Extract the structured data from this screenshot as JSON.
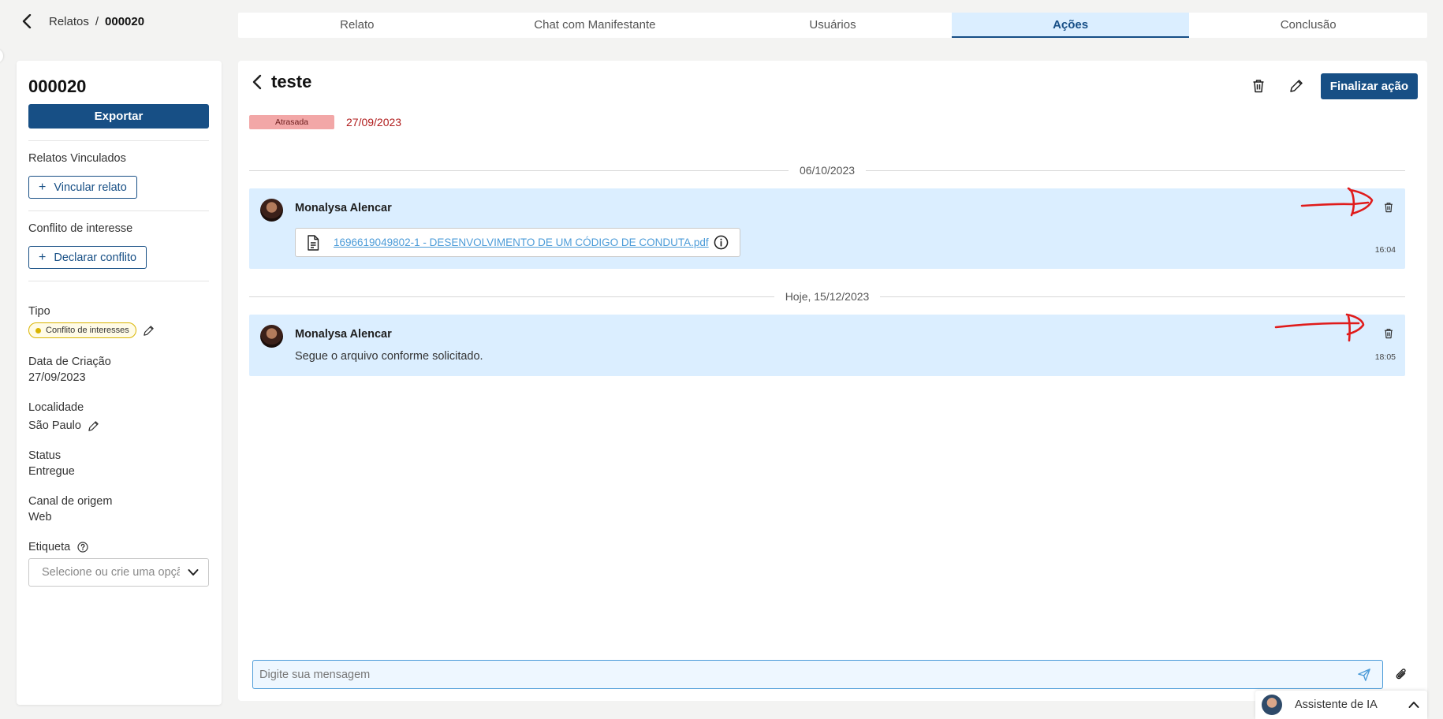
{
  "breadcrumb": {
    "parent": "Relatos",
    "separator": "/",
    "current": "000020"
  },
  "tabs": [
    {
      "label": "Relato"
    },
    {
      "label": "Chat com Manifestante"
    },
    {
      "label": "Usuários"
    },
    {
      "label": "Ações",
      "active": true
    },
    {
      "label": "Conclusão"
    }
  ],
  "sidebar": {
    "case_id": "000020",
    "export_label": "Exportar",
    "linked_reports_label": "Relatos Vinculados",
    "link_report_button": "Vincular relato",
    "conflict_label": "Conflito de interesse",
    "declare_conflict_button": "Declarar conflito",
    "type_label": "Tipo",
    "type_value": "Conflito de interesses",
    "created_label": "Data de Criação",
    "created_value": "27/09/2023",
    "locality_label": "Localidade",
    "locality_value": "São Paulo",
    "status_label": "Status",
    "status_value": "Entregue",
    "channel_label": "Canal de origem",
    "channel_value": "Web",
    "tag_label": "Etiqueta",
    "tag_placeholder": "Selecione ou crie uma opção"
  },
  "action": {
    "title": "teste",
    "finalize_label": "Finalizar ação",
    "status_badge": "Atrasada",
    "due_date": "27/09/2023"
  },
  "timeline": {
    "date_1": "06/10/2023",
    "date_2": "Hoje, 15/12/2023",
    "messages": [
      {
        "author": "Monalysa Alencar",
        "attachment": "1696619049802-1 - DESENVOLVIMENTO DE UM CÓDIGO DE CONDUTA.pdf",
        "time": "16:04"
      },
      {
        "author": "Monalysa Alencar",
        "text": "Segue o arquivo conforme solicitado.",
        "time": "18:05"
      }
    ]
  },
  "composer": {
    "placeholder": "Digite sua mensagem"
  },
  "assistant": {
    "label": "Assistente de IA"
  },
  "colors": {
    "primary": "#174f85",
    "tab_active_bg": "#dbeeff",
    "message_bg": "#dbeeff",
    "late_badge": "#f2a7a7",
    "late_text": "#b01c1c",
    "annotation_red": "#e01b1b",
    "link": "#4b9bd8"
  }
}
